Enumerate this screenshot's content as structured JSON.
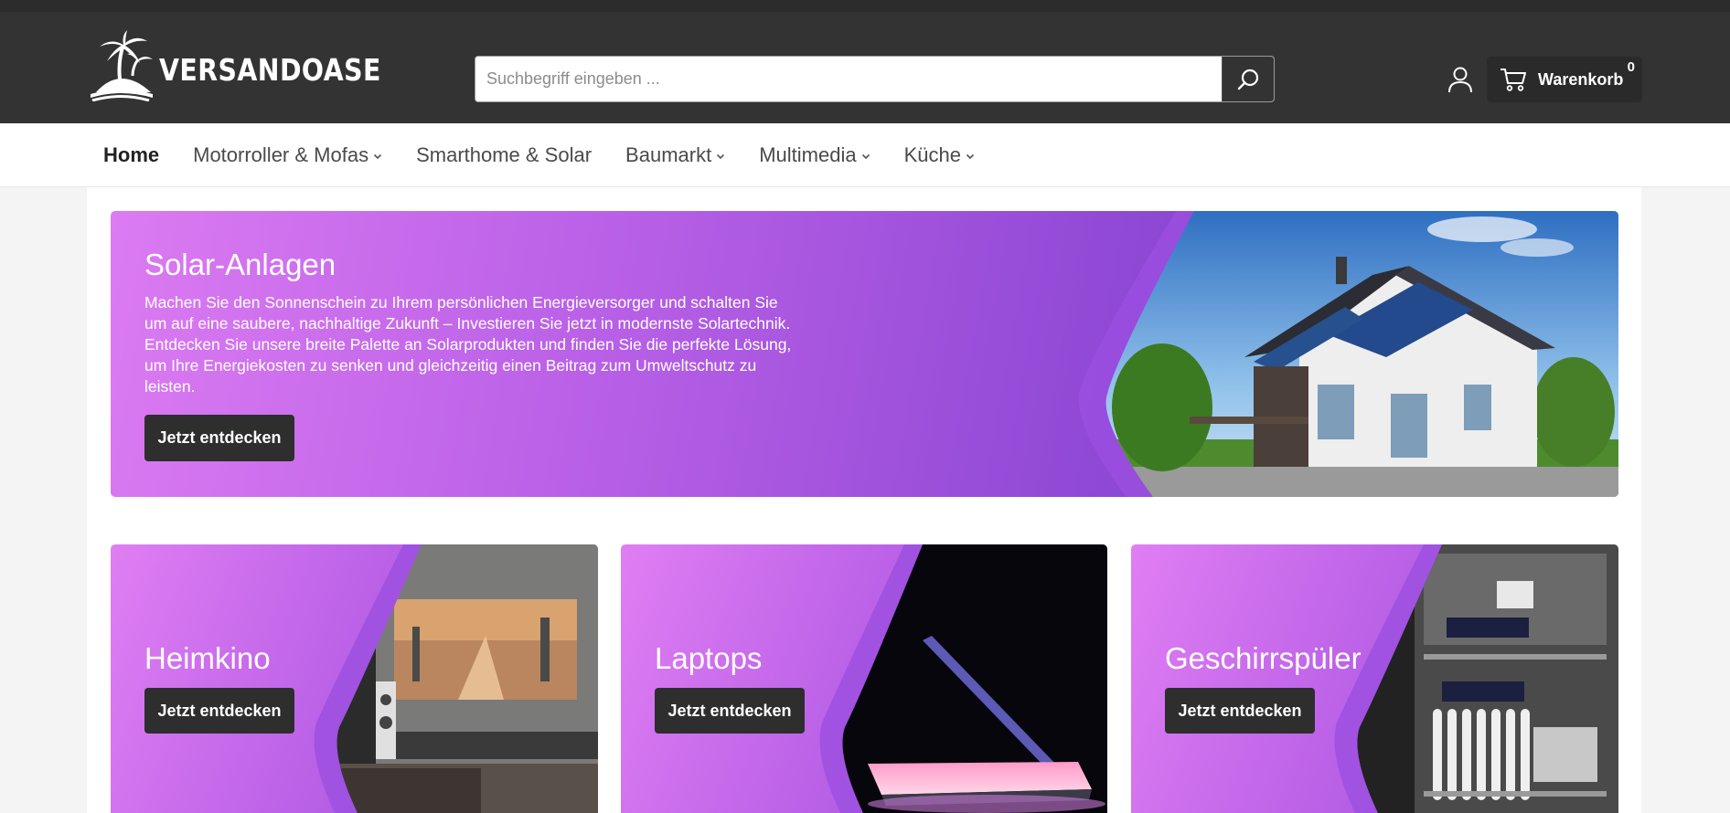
{
  "header": {
    "logo_text": "VERSANDOASE",
    "search_placeholder": "Suchbegriff eingeben ...",
    "cart_label": "Warenkorb",
    "cart_count": "0"
  },
  "nav": {
    "items": [
      {
        "label": "Home",
        "dropdown": false,
        "active": true
      },
      {
        "label": "Motorroller & Mofas",
        "dropdown": true
      },
      {
        "label": "Smarthome & Solar",
        "dropdown": false
      },
      {
        "label": "Baumarkt",
        "dropdown": true
      },
      {
        "label": "Multimedia",
        "dropdown": true
      },
      {
        "label": "Küche",
        "dropdown": true
      }
    ]
  },
  "hero": {
    "title": "Solar-Anlagen",
    "text": "Machen Sie den Sonnenschein zu Ihrem persönlichen Energieversorger und schalten Sie um auf eine saubere, nachhaltige Zukunft – Investieren Sie jetzt in modernste Solartechnik. Entdecken Sie unsere breite Palette an Solarprodukten und finden Sie die perfekte Lösung, um Ihre Energiekosten zu senken und gleichzeitig einen Beitrag zum Umweltschutz zu leisten.",
    "button": "Jetzt entdecken"
  },
  "tiles": [
    {
      "title": "Heimkino",
      "button": "Jetzt entdecken"
    },
    {
      "title": "Laptops",
      "button": "Jetzt entdecken"
    },
    {
      "title": "Geschirrspüler",
      "button": "Jetzt entdecken"
    }
  ],
  "colors": {
    "header_bg": "#333333",
    "button_bg": "#2e2e2e",
    "accent_purple": "#b65ee6"
  }
}
